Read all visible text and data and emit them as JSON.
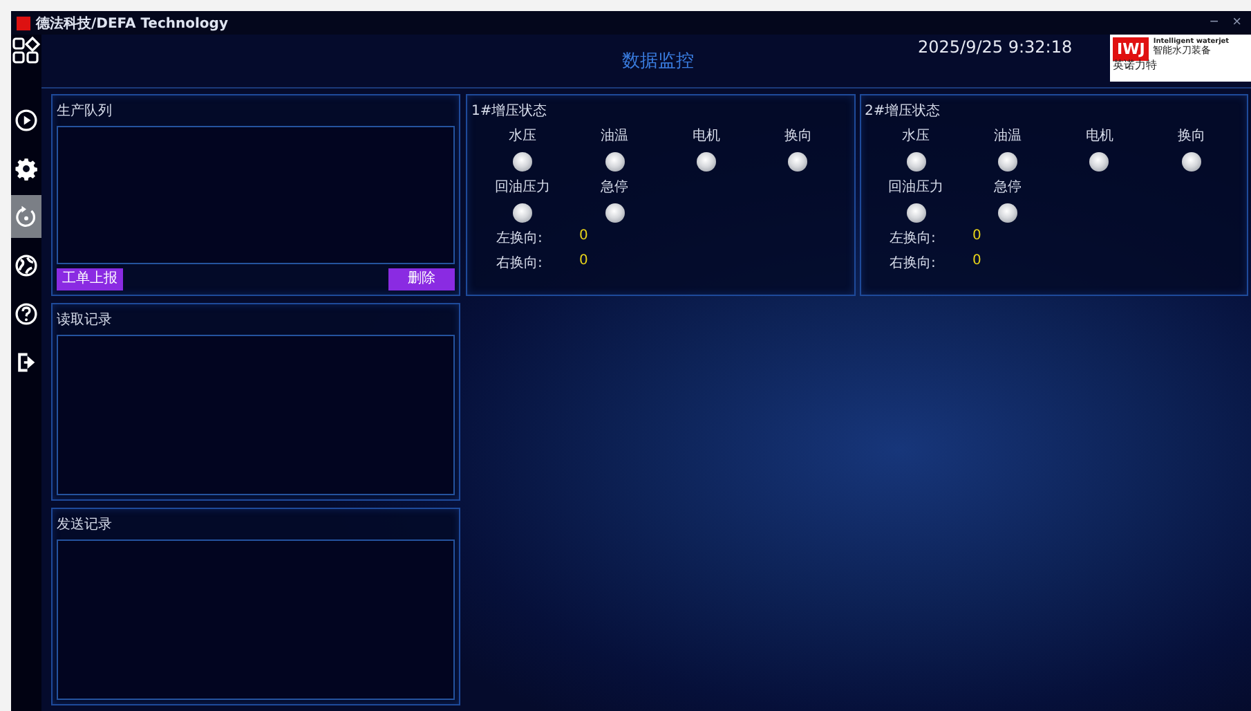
{
  "window": {
    "title": "德法科技/DEFA Technology",
    "controls": [
      "−",
      "×"
    ]
  },
  "header": {
    "title": "数据监控",
    "datetime": "2025/9/25 9:32:18",
    "logo": {
      "mark": "IWJ",
      "tagline": "Intelligent waterjet",
      "subtitle": "智能水刀装备",
      "name": "英诺力特"
    }
  },
  "sidebar": {
    "items": [
      {
        "kind": "play",
        "selected": false
      },
      {
        "kind": "settings",
        "selected": false
      },
      {
        "kind": "refresh",
        "selected": true
      },
      {
        "kind": "globe",
        "selected": false
      },
      {
        "kind": "help",
        "selected": false
      },
      {
        "kind": "logout",
        "selected": false
      }
    ]
  },
  "queue": {
    "title": "生产队列",
    "buttons": [
      "工单上报",
      "删除"
    ]
  },
  "read_log": {
    "title": "读取记录"
  },
  "send_log": {
    "title": "发送记录"
  },
  "status_panels": [
    {
      "title": "1#增压状态",
      "lights": [
        {
          "label": "水压",
          "on": false
        },
        {
          "label": "油温",
          "on": false
        },
        {
          "label": "电机",
          "on": false
        },
        {
          "label": "换向",
          "on": false
        },
        {
          "label": "回油压力",
          "on": false
        },
        {
          "label": "急停",
          "on": false
        }
      ],
      "readings": [
        {
          "label": "左换向:",
          "value": "0"
        },
        {
          "label": "右换向:",
          "value": "0"
        }
      ]
    },
    {
      "title": "2#增压状态",
      "lights": [
        {
          "label": "水压",
          "on": false
        },
        {
          "label": "油温",
          "on": false
        },
        {
          "label": "电机",
          "on": false
        },
        {
          "label": "换向",
          "on": false
        },
        {
          "label": "回油压力",
          "on": false
        },
        {
          "label": "急停",
          "on": false
        }
      ],
      "readings": [
        {
          "label": "左换向:",
          "value": "0"
        },
        {
          "label": "右换向:",
          "value": "0"
        }
      ]
    }
  ]
}
